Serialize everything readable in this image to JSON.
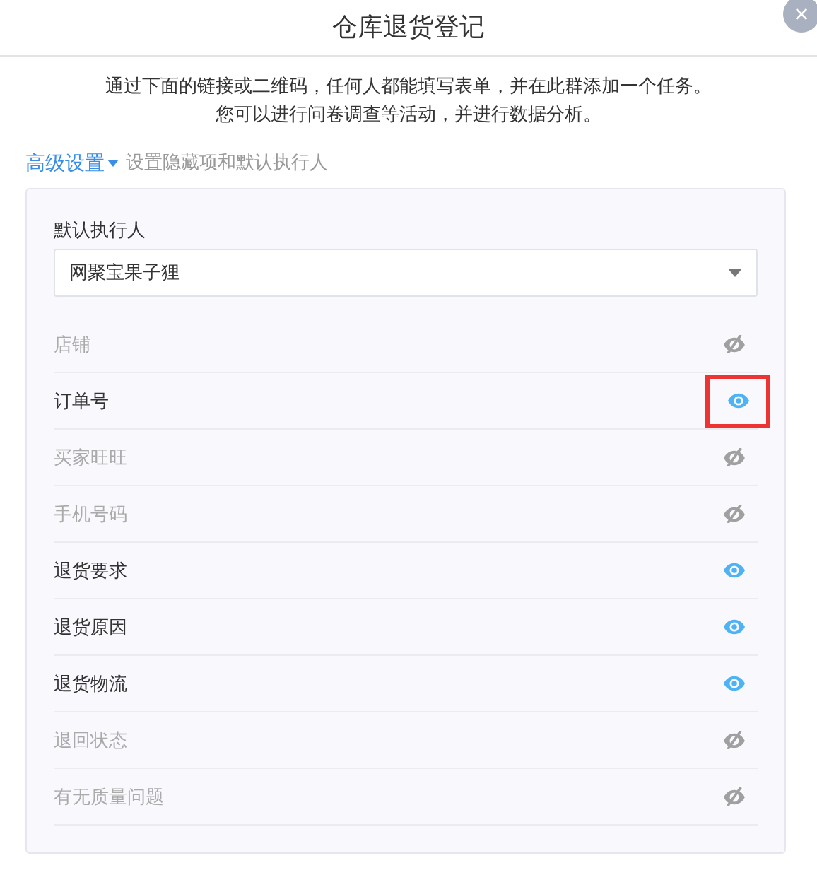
{
  "dialog": {
    "title": "仓库退货登记",
    "close": "×"
  },
  "description": [
    "通过下面的链接或二维码，任何人都能填写表单，并在此群添加一个任务。",
    "您可以进行问卷调查等活动，并进行数据分析。"
  ],
  "advanced": {
    "label": "高级设置",
    "expanded": true,
    "hint": "设置隐藏项和默认执行人"
  },
  "assignee": {
    "label": "默认执行人",
    "value": "网聚宝果子狸"
  },
  "fields": [
    {
      "name": "店铺",
      "visible": false,
      "highlighted": false
    },
    {
      "name": "订单号",
      "visible": true,
      "highlighted": true
    },
    {
      "name": "买家旺旺",
      "visible": false,
      "highlighted": false
    },
    {
      "name": "手机号码",
      "visible": false,
      "highlighted": false
    },
    {
      "name": "退货要求",
      "visible": true,
      "highlighted": false
    },
    {
      "name": "退货原因",
      "visible": true,
      "highlighted": false
    },
    {
      "name": "退货物流",
      "visible": true,
      "highlighted": false
    },
    {
      "name": "退回状态",
      "visible": false,
      "highlighted": false
    },
    {
      "name": "有无质量问题",
      "visible": false,
      "highlighted": false
    }
  ]
}
